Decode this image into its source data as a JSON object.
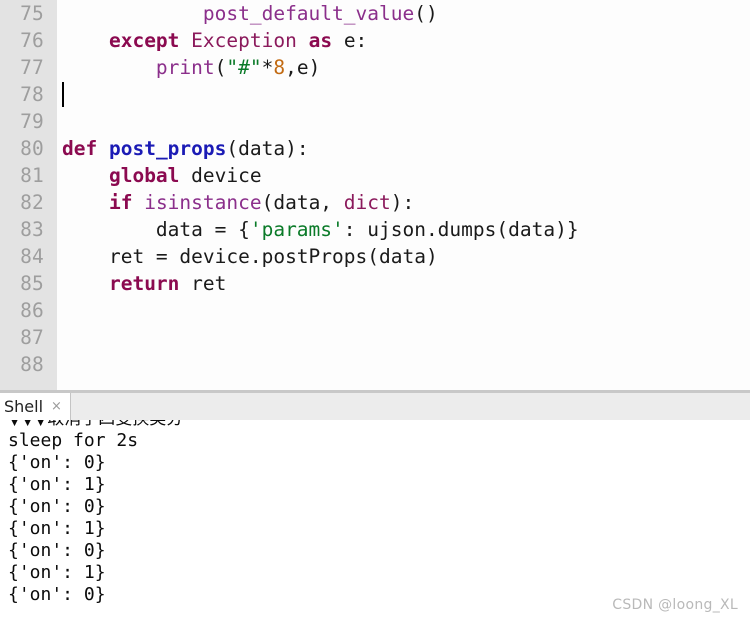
{
  "editor": {
    "gutter_bg": "#e3e3e3",
    "background": "#fdfdfd",
    "lines": [
      {
        "no": "75",
        "indent": "            ",
        "text": "post_default_value()"
      },
      {
        "no": "76",
        "indent": "    ",
        "text": "except Exception as e:"
      },
      {
        "no": "77",
        "indent": "        ",
        "text": "print(\"#\"*8,e)"
      },
      {
        "no": "78",
        "indent": "",
        "text": ""
      },
      {
        "no": "79",
        "indent": "",
        "text": ""
      },
      {
        "no": "80",
        "indent": "",
        "text": "def post_props(data):"
      },
      {
        "no": "81",
        "indent": "    ",
        "text": "global device"
      },
      {
        "no": "82",
        "indent": "    ",
        "text": "if isinstance(data, dict):"
      },
      {
        "no": "83",
        "indent": "        ",
        "text": "data = {'params': ujson.dumps(data)}"
      },
      {
        "no": "84",
        "indent": "    ",
        "text": "ret = device.postProps(data)"
      },
      {
        "no": "85",
        "indent": "    ",
        "text": "return ret"
      },
      {
        "no": "86",
        "indent": "",
        "text": ""
      },
      {
        "no": "87",
        "indent": "",
        "text": ""
      },
      {
        "no": "88",
        "indent": "",
        "text": ""
      }
    ],
    "cursor_line": "78"
  },
  "tabs": {
    "shell": {
      "label": "Shell",
      "close_glyph": "×"
    }
  },
  "console": {
    "clipped_line": "▼▼▼取消了四变换类分",
    "lines": [
      "sleep for 2s",
      "{'on': 0}",
      "{'on': 1}",
      "{'on': 0}",
      "{'on': 1}",
      "{'on': 0}",
      "{'on': 1}",
      "{'on': 0}"
    ]
  },
  "watermark": {
    "text": "CSDN @loong_XL"
  },
  "colors": {
    "keyword": "#8b0a50",
    "function": "#1b1bb5",
    "builtin": "#8b2f8b",
    "type": "#8b1a5c",
    "string": "#0a7a28",
    "number": "#c26a12",
    "plain": "#1a1a1a",
    "lineno": "#9e9e9e"
  }
}
